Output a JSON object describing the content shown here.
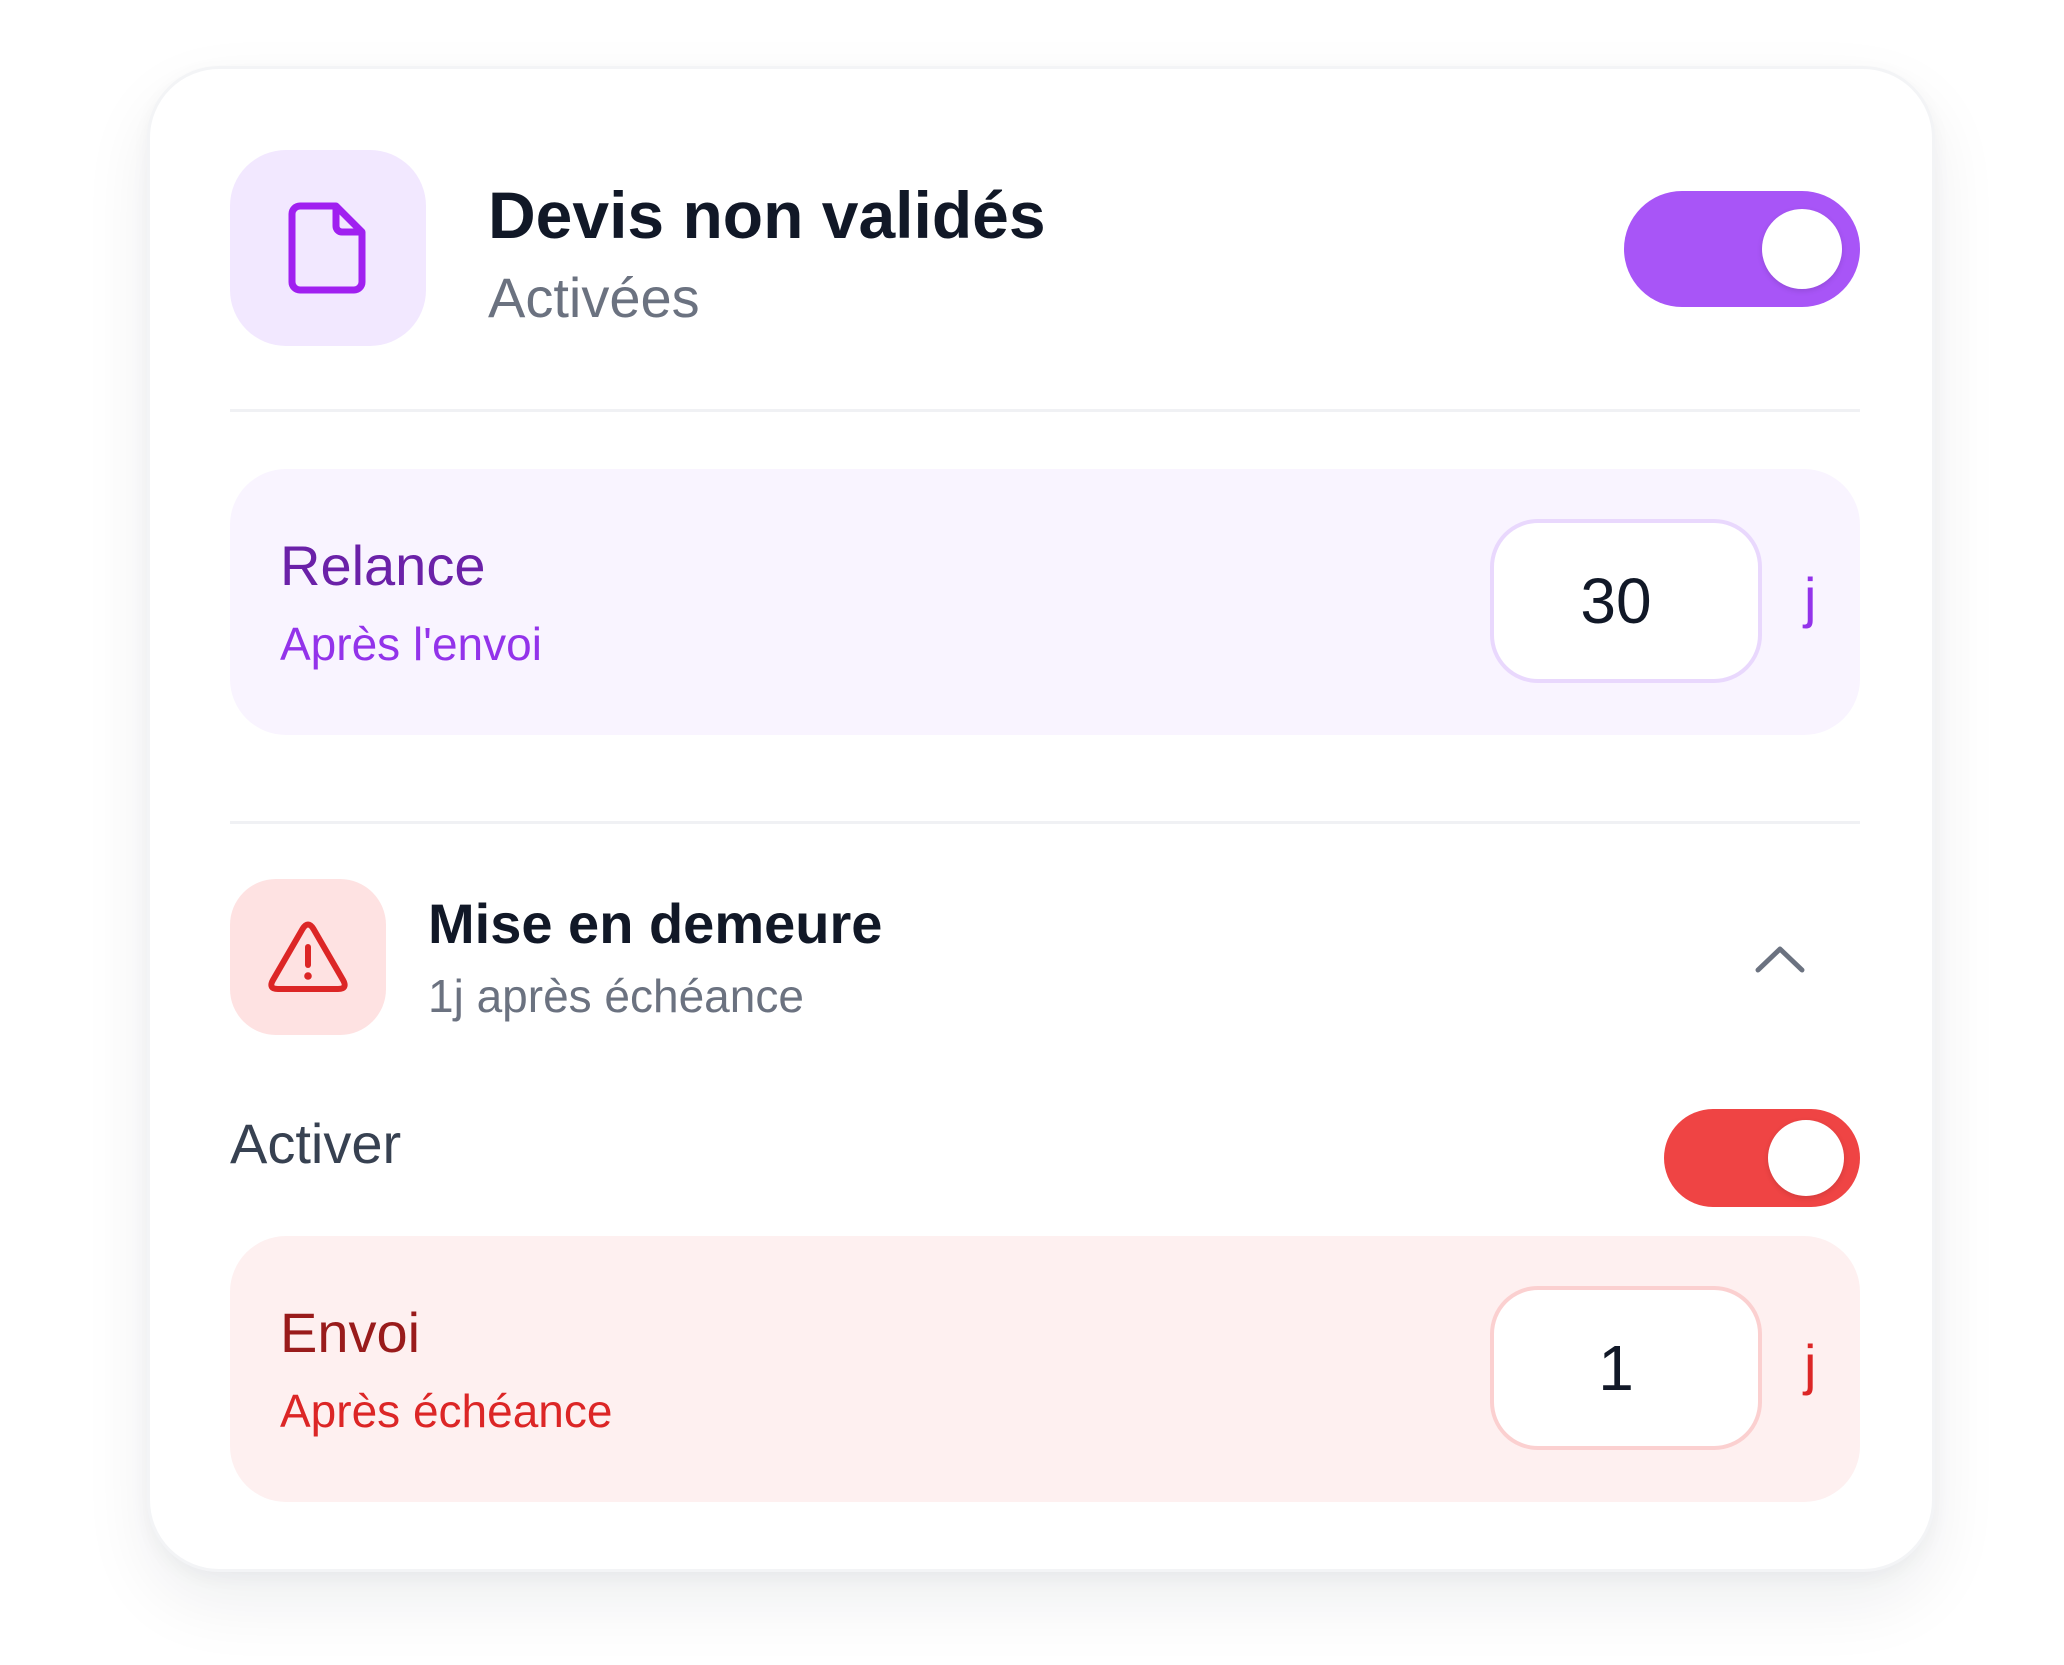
{
  "header": {
    "icon": "document-icon",
    "title": "Devis non validés",
    "status": "Activées",
    "enabled": true,
    "accent_color": "#a855f7"
  },
  "relance": {
    "title": "Relance",
    "subtitle": "Après l'envoi",
    "value": "30",
    "unit": "j"
  },
  "mise_en_demeure": {
    "icon": "warning-triangle-icon",
    "title": "Mise en demeure",
    "subtitle": "1j après échéance",
    "expanded": true,
    "activer_label": "Activer",
    "enabled": true,
    "accent_color": "#ef4444",
    "envoi": {
      "title": "Envoi",
      "subtitle": "Après échéance",
      "value": "1",
      "unit": "j"
    }
  }
}
